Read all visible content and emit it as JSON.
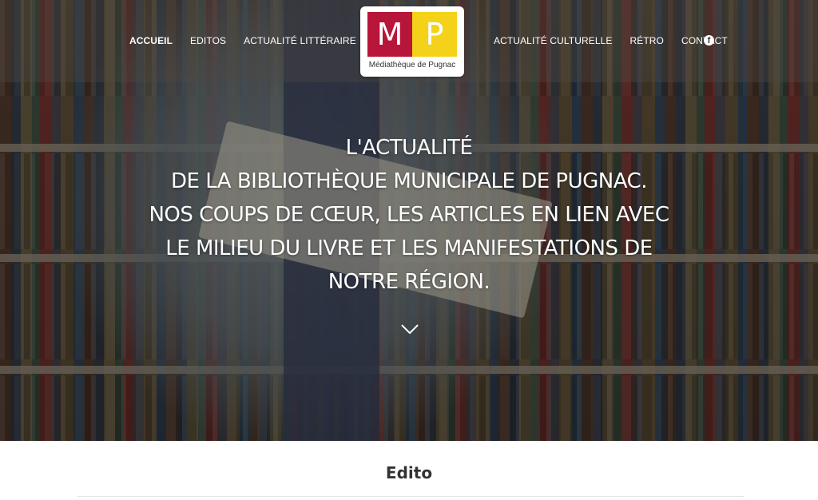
{
  "nav": {
    "left": [
      "Accueil",
      "Editos",
      "Actualité littéraire"
    ],
    "right": [
      "Actualité culturelle",
      "Rétro",
      "Contact"
    ],
    "active": "Accueil",
    "social_icon": "facebook-icon"
  },
  "logo": {
    "letter_left": "M",
    "letter_right": "P",
    "name": "Médiathèque de Pugnac",
    "colors": {
      "left": "#b8153a",
      "right": "#f4d21a"
    }
  },
  "hero": {
    "lines": [
      "L'actualité",
      "de la bibliothèque municipale de Pugnac.",
      "Nos coups de cœur, les articles en lien avec",
      "le milieu du livre et les manifestations de",
      "notre région."
    ],
    "scroll_icon": "chevron-down-icon"
  },
  "section": {
    "title": "Edito"
  }
}
